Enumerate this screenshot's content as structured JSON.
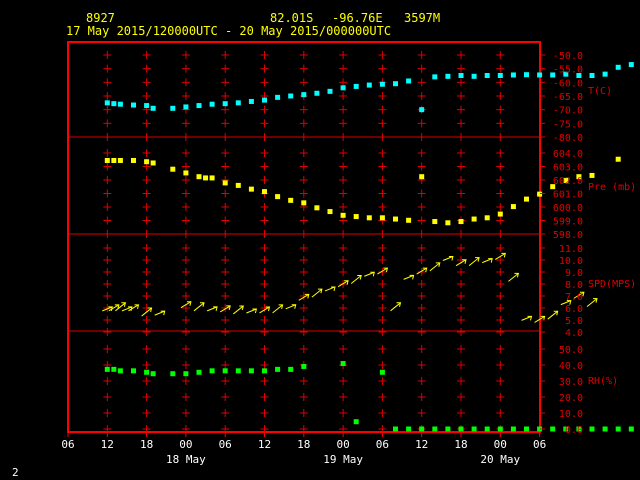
{
  "header": {
    "station_id": "8927",
    "lat": "82.01S",
    "lon": "-96.76E",
    "elev": "3597M",
    "period": "17 May 2015/120000UTC - 20 May 2015/000000UTC"
  },
  "page_number": "2",
  "x_axis": {
    "tick_labels": [
      "06",
      "12",
      "18",
      "00",
      "06",
      "12",
      "18",
      "00",
      "06",
      "12",
      "18",
      "00",
      "06"
    ],
    "day_labels": [
      "18 May",
      "19 May",
      "20 May"
    ]
  },
  "colors": {
    "frame": "#ff0000",
    "grid": "#e00000",
    "temperature": "#00ffff",
    "pressure": "#ffff00",
    "wind": "#ffff00",
    "rh": "#00ff00",
    "text": "#ffffff"
  },
  "chart_data": [
    {
      "type": "scatter",
      "name": "temperature",
      "title": "T(C)",
      "y_ticks": [
        "-50.0",
        "-55.0",
        "-60.0",
        "-65.0",
        "-70.0",
        "-75.0",
        "-80.0"
      ],
      "ylim": [
        -80,
        -50
      ],
      "x_unit": "hours since 17 May 2015 12 UTC",
      "points": [
        [
          0,
          -67.5
        ],
        [
          1,
          -67.8
        ],
        [
          2,
          -68
        ],
        [
          4,
          -68.3
        ],
        [
          6,
          -68.5
        ],
        [
          7,
          -69.5
        ],
        [
          10,
          -69.5
        ],
        [
          12,
          -69
        ],
        [
          14,
          -68.5
        ],
        [
          16,
          -68
        ],
        [
          18,
          -67.8
        ],
        [
          20,
          -67.5
        ],
        [
          22,
          -67
        ],
        [
          24,
          -66.5
        ],
        [
          26,
          -65.5
        ],
        [
          28,
          -65
        ],
        [
          30,
          -64.5
        ],
        [
          32,
          -64
        ],
        [
          34,
          -63.3
        ],
        [
          36,
          -62
        ],
        [
          38,
          -61.5
        ],
        [
          40,
          -61
        ],
        [
          42,
          -60.7
        ],
        [
          44,
          -60.5
        ],
        [
          46,
          -59.5
        ],
        [
          48,
          -70
        ],
        [
          50,
          -58
        ],
        [
          52,
          -57.8
        ],
        [
          54,
          -57.5
        ],
        [
          56,
          -57.8
        ],
        [
          58,
          -57.5
        ],
        [
          60,
          -57.5
        ],
        [
          62,
          -57.3
        ],
        [
          64,
          -57.2
        ],
        [
          66,
          -57.3
        ],
        [
          68,
          -57.3
        ],
        [
          70,
          -57
        ],
        [
          72,
          -57.5
        ],
        [
          74,
          -57.5
        ],
        [
          76,
          -57
        ],
        [
          78,
          -54.5
        ],
        [
          80,
          -53.5
        ],
        [
          84,
          -53
        ]
      ]
    },
    {
      "type": "scatter",
      "name": "pressure",
      "title": "Pre (mb)",
      "y_ticks": [
        "604.0",
        "603.0",
        "602.0",
        "601.0",
        "600.0",
        "599.0",
        "598.0"
      ],
      "ylim": [
        598,
        604.5
      ],
      "x_unit": "hours since 17 May 2015 12 UTC",
      "points": [
        [
          0,
          603.9
        ],
        [
          1,
          603.9
        ],
        [
          2,
          603.9
        ],
        [
          4,
          603.9
        ],
        [
          6,
          603.8
        ],
        [
          7,
          603.7
        ],
        [
          10,
          603.2
        ],
        [
          12,
          602.9
        ],
        [
          14,
          602.6
        ],
        [
          15,
          602.5
        ],
        [
          16,
          602.5
        ],
        [
          18,
          602.1
        ],
        [
          20,
          601.9
        ],
        [
          22,
          601.6
        ],
        [
          24,
          601.4
        ],
        [
          26,
          601
        ],
        [
          28,
          600.7
        ],
        [
          30,
          600.5
        ],
        [
          32,
          600.1
        ],
        [
          34,
          599.8
        ],
        [
          36,
          599.5
        ],
        [
          38,
          599.4
        ],
        [
          40,
          599.3
        ],
        [
          42,
          599.3
        ],
        [
          44,
          599.2
        ],
        [
          46,
          599.1
        ],
        [
          48,
          602.6
        ],
        [
          50,
          599
        ],
        [
          52,
          598.9
        ],
        [
          54,
          599
        ],
        [
          56,
          599.2
        ],
        [
          58,
          599.3
        ],
        [
          60,
          599.6
        ],
        [
          62,
          600.2
        ],
        [
          64,
          600.8
        ],
        [
          66,
          601.2
        ],
        [
          68,
          601.8
        ],
        [
          70,
          602.3
        ],
        [
          72,
          602.6
        ],
        [
          74,
          602.7
        ],
        [
          78,
          604
        ]
      ]
    },
    {
      "type": "scatter",
      "name": "wind",
      "title": "SPD(MPS)",
      "y_ticks": [
        "11.0",
        "10.0",
        "9.0",
        "8.0",
        "7.0",
        "6.0",
        "5.0",
        "4.0"
      ],
      "ylim": [
        4,
        12
      ],
      "x_unit": "hours since 17 May 2015 12 UTC",
      "points": [
        [
          0,
          6.2
        ],
        [
          1,
          6.3
        ],
        [
          2,
          6.4
        ],
        [
          3,
          6.2
        ],
        [
          4,
          6.3
        ],
        [
          6,
          5.9
        ],
        [
          8,
          5.8
        ],
        [
          12,
          6.6
        ],
        [
          14,
          6.4
        ],
        [
          16,
          6.2
        ],
        [
          18,
          6.2
        ],
        [
          20,
          6.1
        ],
        [
          22,
          6
        ],
        [
          24,
          6.1
        ],
        [
          26,
          6.2
        ],
        [
          28,
          6.4
        ],
        [
          30,
          7.3
        ],
        [
          32,
          7.7
        ],
        [
          34,
          8.1
        ],
        [
          36,
          8.6
        ],
        [
          38,
          9
        ],
        [
          40,
          9.5
        ],
        [
          42,
          9.8
        ],
        [
          44,
          6.4
        ],
        [
          46,
          9.2
        ],
        [
          48,
          9.8
        ],
        [
          50,
          10.2
        ],
        [
          52,
          11
        ],
        [
          54,
          10.6
        ],
        [
          56,
          10.7
        ],
        [
          58,
          10.8
        ],
        [
          60,
          11.2
        ],
        [
          62,
          9.2
        ],
        [
          64,
          5.3
        ],
        [
          66,
          5.2
        ],
        [
          68,
          5.6
        ],
        [
          70,
          6.8
        ],
        [
          72,
          7.5
        ],
        [
          74,
          6.8
        ]
      ]
    },
    {
      "type": "scatter",
      "name": "rh",
      "title": "RH(%)",
      "y_ticks": [
        "50.0",
        "40.0",
        "30.0",
        "20.0",
        "10.0",
        "0.0"
      ],
      "ylim": [
        0,
        55
      ],
      "x_unit": "hours since 17 May 2015 12 UTC",
      "points": [
        [
          0,
          41
        ],
        [
          1,
          41
        ],
        [
          2,
          40
        ],
        [
          4,
          40
        ],
        [
          6,
          39
        ],
        [
          7,
          38
        ],
        [
          10,
          38
        ],
        [
          12,
          38
        ],
        [
          14,
          39
        ],
        [
          16,
          40
        ],
        [
          18,
          40
        ],
        [
          20,
          40
        ],
        [
          22,
          40
        ],
        [
          24,
          40
        ],
        [
          26,
          41
        ],
        [
          28,
          41
        ],
        [
          30,
          43
        ],
        [
          36,
          45
        ],
        [
          38,
          5
        ],
        [
          42,
          39
        ],
        [
          44,
          0
        ],
        [
          46,
          0
        ],
        [
          48,
          0
        ],
        [
          50,
          0
        ],
        [
          52,
          0
        ],
        [
          54,
          0
        ],
        [
          56,
          0
        ],
        [
          58,
          0
        ],
        [
          60,
          0
        ],
        [
          62,
          0
        ],
        [
          64,
          0
        ],
        [
          66,
          0
        ],
        [
          68,
          0
        ],
        [
          70,
          0
        ],
        [
          72,
          0
        ],
        [
          74,
          0
        ],
        [
          76,
          0
        ],
        [
          78,
          0
        ],
        [
          80,
          0
        ],
        [
          82,
          0
        ],
        [
          84,
          0
        ],
        [
          86,
          0
        ],
        [
          88,
          0
        ]
      ]
    }
  ]
}
